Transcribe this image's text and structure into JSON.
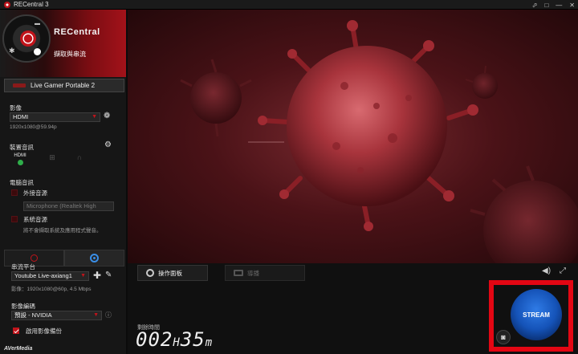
{
  "window": {
    "title": "RECentral 3",
    "controls": [
      "⬀",
      "□",
      "—",
      "✕"
    ]
  },
  "brand": {
    "logo": "RECentral",
    "mode": "擷取與串流"
  },
  "device": {
    "name": "Live Gamer Portable 2"
  },
  "video": {
    "label": "影像",
    "source": "HDMI",
    "resolution": "1920x1080@59.94p"
  },
  "device_audio": {
    "label": "裝置音訊",
    "hdmi_label": "HDMI"
  },
  "pc_audio": {
    "label": "電腦音訊",
    "external_label": "外接音源",
    "external_device": "Microphone (Realtek High",
    "system_label": "系統音源",
    "system_note": "將不會擷取系統及應用程式聲音。"
  },
  "streaming": {
    "platform_label": "串流平台",
    "platform": "Youtube Live-axiang1",
    "platform_info": "影像：1920x1080@60p, 4.5 Mbps",
    "encoder_label": "影像編碼",
    "encoder": "預設 - NVIDIA",
    "backup_label": "啟用影像備份",
    "backup_checked": true
  },
  "footer": {
    "brand": "AVerMedia"
  },
  "control_panel": {
    "tab_active": "操作面板",
    "tab_inactive": "導播",
    "timer_label": "剩餘時間",
    "timer_hours": "002",
    "timer_h": "H",
    "timer_minutes": "35",
    "timer_m": "m",
    "stream_button": "STREAM"
  },
  "colors": {
    "accent": "#c0141b",
    "stream_blue": "#1553b8",
    "highlight_frame": "#e30613"
  }
}
